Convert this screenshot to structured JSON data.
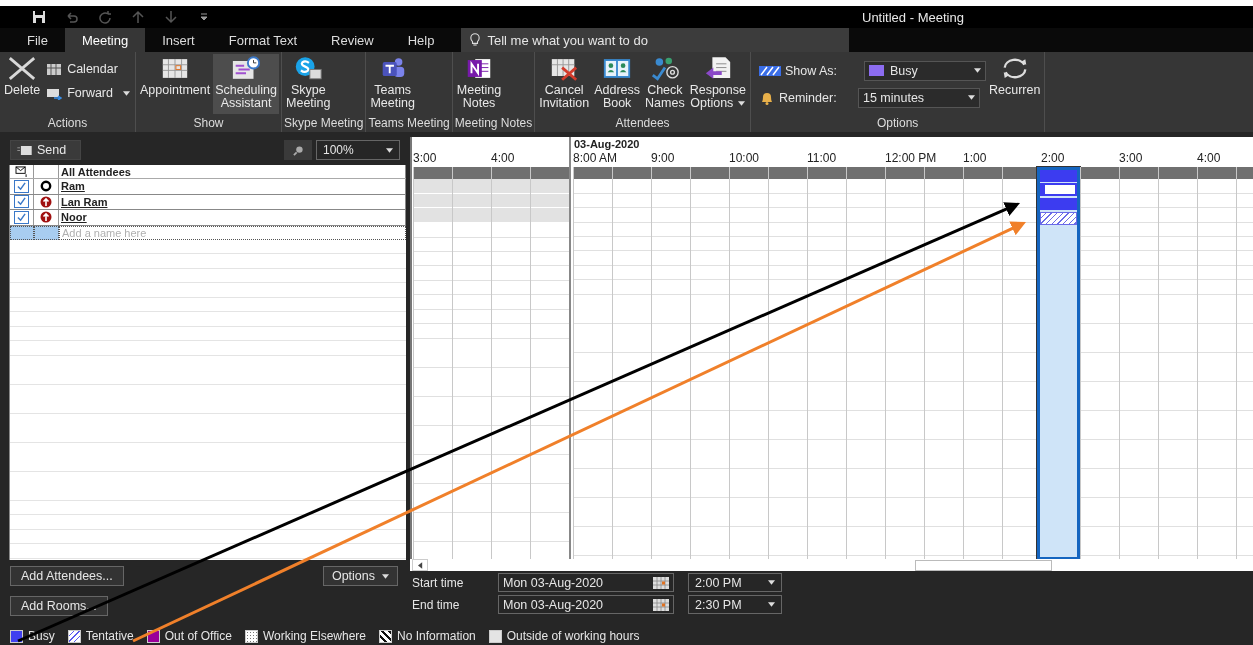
{
  "window": {
    "title": "Untitled  -  Meeting"
  },
  "tabs": [
    {
      "label": "File",
      "selected": false
    },
    {
      "label": "Meeting",
      "selected": true
    },
    {
      "label": "Insert",
      "selected": false
    },
    {
      "label": "Format Text",
      "selected": false
    },
    {
      "label": "Review",
      "selected": false
    },
    {
      "label": "Help",
      "selected": false
    }
  ],
  "tell_me": {
    "placeholder": "Tell me what you want to do"
  },
  "ribbon": {
    "groups": [
      {
        "label": "Actions",
        "items": [
          {
            "kind": "large",
            "label": "Delete",
            "selected": false
          },
          {
            "kind": "small",
            "label": "Calendar",
            "selected": false
          },
          {
            "kind": "small",
            "label": "Forward",
            "selected": false,
            "dropdown": true
          }
        ]
      },
      {
        "label": "Show",
        "items": [
          {
            "kind": "large",
            "label": "Appointment",
            "selected": false
          },
          {
            "kind": "large",
            "label": "Scheduling\nAssistant",
            "selected": true
          }
        ]
      },
      {
        "label": "Skype Meeting",
        "items": [
          {
            "kind": "large",
            "label": "Skype\nMeeting",
            "selected": false
          }
        ]
      },
      {
        "label": "Teams Meeting",
        "items": [
          {
            "kind": "large",
            "label": "Teams\nMeeting",
            "selected": false
          }
        ]
      },
      {
        "label": "Meeting Notes",
        "items": [
          {
            "kind": "large",
            "label": "Meeting\nNotes",
            "selected": false
          }
        ]
      },
      {
        "label": "Attendees",
        "items": [
          {
            "kind": "large",
            "label": "Cancel\nInvitation",
            "selected": false
          },
          {
            "kind": "large",
            "label": "Address\nBook",
            "selected": false
          },
          {
            "kind": "large",
            "label": "Check\nNames",
            "selected": false
          },
          {
            "kind": "large",
            "label": "Response\nOptions",
            "selected": false,
            "dropdown": true
          }
        ]
      },
      {
        "label": "Options",
        "items": [
          {
            "kind": "field",
            "label": "Show As:",
            "value": "Busy"
          },
          {
            "kind": "field",
            "label": "Reminder:",
            "value": "15 minutes"
          },
          {
            "kind": "large",
            "label": "Recurren",
            "selected": false
          }
        ]
      }
    ]
  },
  "attendees": {
    "send": "Send",
    "zoom": "100%",
    "header": "All Attendees",
    "rows": [
      {
        "name": "Ram",
        "checked": true,
        "kind": "organizer"
      },
      {
        "name": "Lan Ram",
        "checked": true,
        "kind": "required"
      },
      {
        "name": "Noor",
        "checked": true,
        "kind": "required"
      }
    ],
    "add_placeholder": "Add a name here"
  },
  "timeline": {
    "groups": [
      {
        "working": false,
        "hours": [
          {
            "label": "3:00",
            "meeting": false
          },
          {
            "label": "4:00",
            "meeting": false
          }
        ]
      },
      {
        "working": true,
        "date": "03-Aug-2020",
        "hours": [
          {
            "label": "8:00 AM",
            "meeting": false
          },
          {
            "label": "9:00",
            "meeting": false
          },
          {
            "label": "10:00",
            "meeting": false
          },
          {
            "label": "11:00",
            "meeting": false
          },
          {
            "label": "12:00 PM",
            "meeting": false
          },
          {
            "label": "1:00",
            "meeting": false
          },
          {
            "label": "2:00",
            "meeting": true
          },
          {
            "label": "3:00",
            "meeting": false
          },
          {
            "label": "4:00",
            "meeting": false
          }
        ]
      }
    ],
    "meeting_blocks": [
      {
        "kind": "busy"
      },
      {
        "kind": "free"
      },
      {
        "kind": "busy"
      },
      {
        "kind": "tentative"
      }
    ]
  },
  "buttons": {
    "add_attendees": "Add Attendees...",
    "options": "Options",
    "add_rooms": "Add Rooms..."
  },
  "times": [
    {
      "label": "Start time",
      "date": "Mon 03-Aug-2020",
      "time": "2:00 PM"
    },
    {
      "label": "End time",
      "date": "Mon 03-Aug-2020",
      "time": "2:30 PM"
    }
  ],
  "legend": [
    {
      "kind": "busy",
      "label": "Busy"
    },
    {
      "kind": "tentative",
      "label": "Tentative"
    },
    {
      "kind": "out_of_office",
      "label": "Out of Office"
    },
    {
      "kind": "working_elsewhere",
      "label": "Working Elsewhere"
    },
    {
      "kind": "no_information",
      "label": "No Information"
    },
    {
      "kind": "outside_hours",
      "label": "Outside of working hours"
    }
  ],
  "annotations": [
    {
      "color": "#000000"
    },
    {
      "color": "#f0802a"
    }
  ]
}
